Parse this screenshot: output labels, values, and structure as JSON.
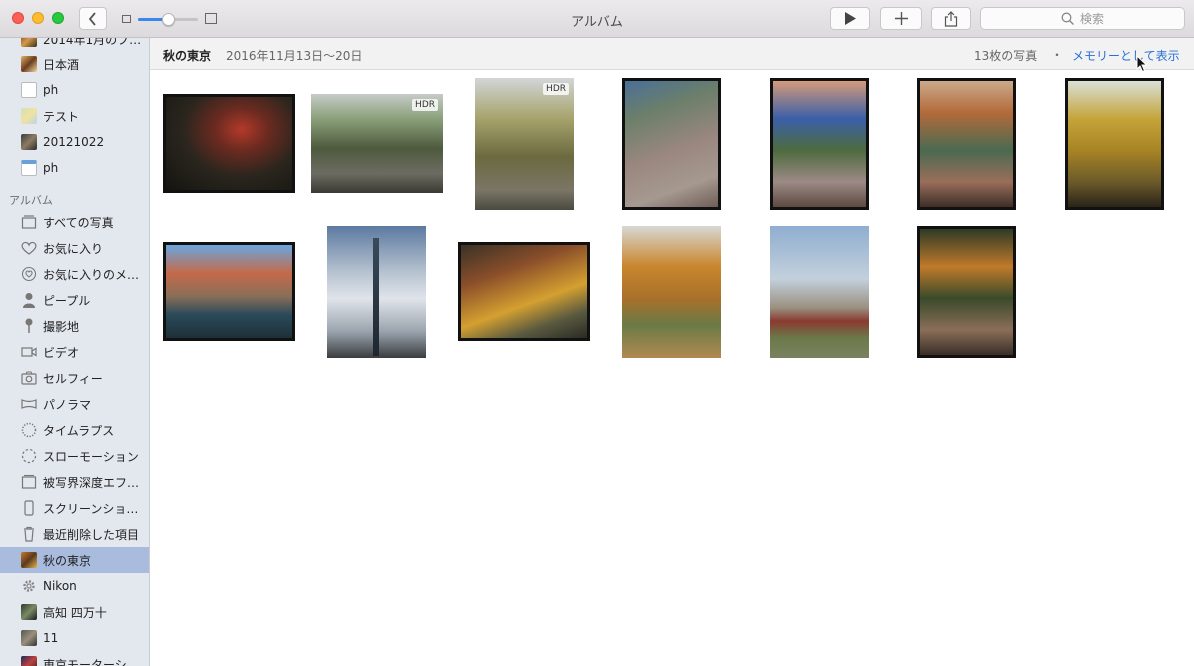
{
  "window": {
    "title": "アルバム",
    "search_placeholder": "検索"
  },
  "sidebar": {
    "top_items": [
      {
        "label": "2014年1月のブ…",
        "thumb": "thumb-photo"
      },
      {
        "label": "日本酒",
        "thumb": "thumb-photo"
      },
      {
        "label": "ph",
        "thumb": "thumb-doc"
      },
      {
        "label": "テスト",
        "thumb": "thumb-map"
      },
      {
        "label": "20121022",
        "thumb": "thumb-photo"
      },
      {
        "label": "ph",
        "thumb": "thumb-doc"
      }
    ],
    "section_label": "アルバム",
    "album_items": [
      {
        "label": "すべての写真",
        "icon": "all-photos-icon"
      },
      {
        "label": "お気に入り",
        "icon": "heart-icon"
      },
      {
        "label": "お気に入りのメ…",
        "icon": "favorite-memories-icon"
      },
      {
        "label": "ピープル",
        "icon": "person-icon"
      },
      {
        "label": "撮影地",
        "icon": "pin-icon"
      },
      {
        "label": "ビデオ",
        "icon": "video-icon"
      },
      {
        "label": "セルフィー",
        "icon": "camera-icon"
      },
      {
        "label": "パノラマ",
        "icon": "panorama-icon"
      },
      {
        "label": "タイムラプス",
        "icon": "timelapse-icon"
      },
      {
        "label": "スローモーション",
        "icon": "slomo-icon"
      },
      {
        "label": "被写界深度エフ…",
        "icon": "depth-icon"
      },
      {
        "label": "スクリーンショ…",
        "icon": "screenshot-icon"
      },
      {
        "label": "最近削除した項目",
        "icon": "trash-icon"
      }
    ],
    "user_albums": [
      {
        "label": "秋の東京",
        "thumb": "thumb-photo",
        "selected": true
      },
      {
        "label": "Nikon",
        "thumb": "gear-icon",
        "selected": false
      },
      {
        "label": "高知 四万十",
        "thumb": "thumb-photo",
        "selected": false
      },
      {
        "label": "11",
        "thumb": "thumb-photo",
        "selected": false
      },
      {
        "label": "東京モーターシ…",
        "thumb": "thumb-photo",
        "selected": false
      }
    ]
  },
  "header": {
    "album_title": "秋の東京",
    "date_range": "2016年11月13日〜20日",
    "photo_count": "13枚の写真",
    "separator": "・",
    "memory_link": "メモリーとして表示"
  },
  "photos": [
    {
      "desc": "autumn garden pond",
      "hdr": false
    },
    {
      "desc": "rocky stream garden",
      "hdr": true,
      "hdr_label": "HDR"
    },
    {
      "desc": "garden path trees",
      "hdr": true,
      "hdr_label": "HDR"
    },
    {
      "desc": "leaf covered path",
      "hdr": false
    },
    {
      "desc": "path with blue building",
      "hdr": false
    },
    {
      "desc": "autumn tree path",
      "hdr": false
    },
    {
      "desc": "yellow ginkgo trees",
      "hdr": false
    },
    {
      "desc": "river with boats",
      "hdr": false
    },
    {
      "desc": "skytree tower",
      "hdr": false
    },
    {
      "desc": "ginkgo avenue",
      "hdr": false
    },
    {
      "desc": "ginkgo path orange",
      "hdr": false
    },
    {
      "desc": "park with skytree",
      "hdr": false
    },
    {
      "desc": "park path dark",
      "hdr": false
    }
  ],
  "colors": {
    "accent": "#3a86f0",
    "link": "#2a6fd6",
    "sidebar_bg": "#e3e7ee",
    "sidebar_selected": "#a9bcdd"
  }
}
